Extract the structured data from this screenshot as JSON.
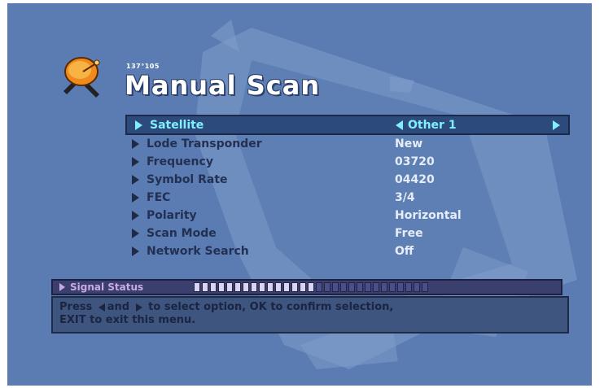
{
  "header": {
    "coordinates": "137°105",
    "title": "Manual Scan"
  },
  "menu": {
    "items": [
      {
        "label": "Satellite",
        "value": "Other 1",
        "selected": true
      },
      {
        "label": "Lode Transponder",
        "value": "New"
      },
      {
        "label": "Frequency",
        "value": "03720"
      },
      {
        "label": "Symbol Rate",
        "value": "04420"
      },
      {
        "label": "FEC",
        "value": "3/4"
      },
      {
        "label": "Polarity",
        "value": "Horizontal"
      },
      {
        "label": "Scan Mode",
        "value": "Free"
      },
      {
        "label": "Network Search",
        "value": "Off"
      }
    ]
  },
  "signal": {
    "label": "Signal Status",
    "level": 0.52,
    "segments_total": 29,
    "segments_on": 15
  },
  "help": {
    "part1": "Press",
    "part2": "and",
    "part3": "to select option, OK to confirm selection,",
    "part4": "EXIT to exit this menu."
  },
  "colors": {
    "background": "#5a7cb2",
    "highlight_text": "#7ff0ff",
    "value_text": "#e6edf8",
    "label_text": "#233052"
  }
}
